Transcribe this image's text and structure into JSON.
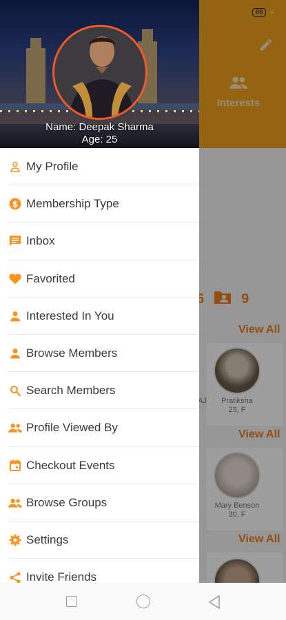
{
  "status_bar": {
    "battery": "86"
  },
  "background": {
    "interests_label": "Interests",
    "stat_left": "6",
    "stat_right": "9",
    "view_all_1": "View All",
    "view_all_2": "View All",
    "view_all_3": "View All",
    "card1_partial": "AJ",
    "card1_name": "Pratiksha",
    "card1_meta": "23, F",
    "card2_name": "Mary Benson",
    "card2_meta": "30, F"
  },
  "drawer": {
    "profile_name": "Name: Deepak Sharma",
    "profile_age": "Age: 25",
    "items": [
      {
        "label": "My Profile",
        "icon": "person-outline-icon"
      },
      {
        "label": "Membership Type",
        "icon": "dollar-circle-icon"
      },
      {
        "label": "Inbox",
        "icon": "message-icon"
      },
      {
        "label": "Favorited",
        "icon": "heart-icon"
      },
      {
        "label": "Interested In You",
        "icon": "person-icon"
      },
      {
        "label": "Browse Members",
        "icon": "person-icon"
      },
      {
        "label": "Search Members",
        "icon": "search-icon"
      },
      {
        "label": "Profile Viewed By",
        "icon": "people-icon"
      },
      {
        "label": "Checkout Events",
        "icon": "calendar-icon"
      },
      {
        "label": "Browse Groups",
        "icon": "people-icon"
      },
      {
        "label": "Settings",
        "icon": "gear-icon"
      },
      {
        "label": "Invite Friends",
        "icon": "share-icon"
      }
    ]
  },
  "colors": {
    "accent": "#f7931e",
    "header_bg": "#f0a21e",
    "profile_border": "#f05a28"
  }
}
